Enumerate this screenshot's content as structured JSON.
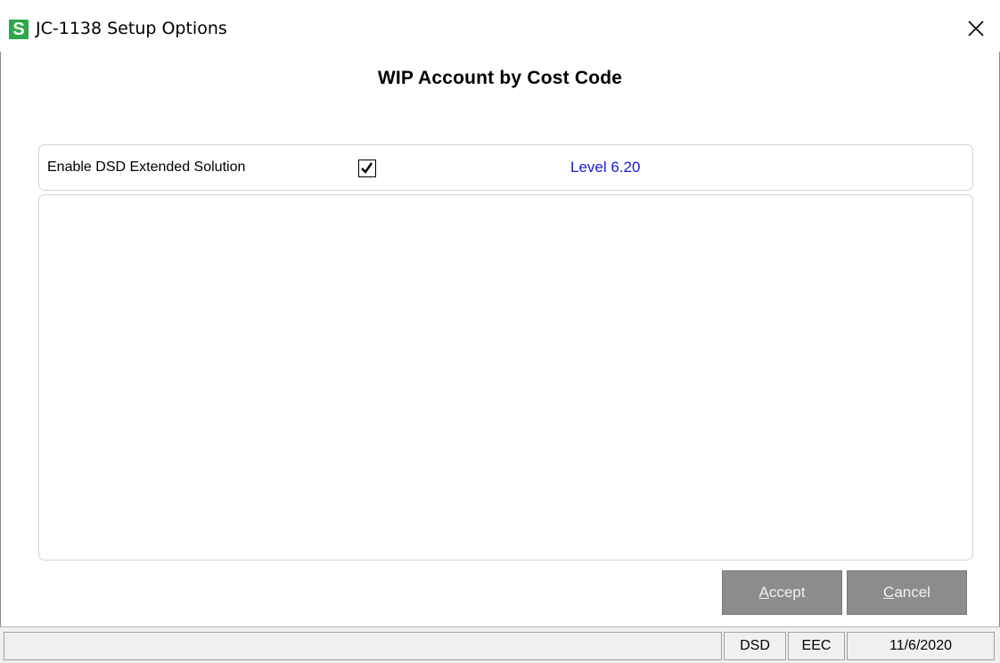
{
  "window": {
    "app_icon_letter": "S",
    "title": "JC-1138 Setup Options",
    "close_icon": "close-icon"
  },
  "heading": "WIP Account by Cost Code",
  "option": {
    "label": "Enable DSD Extended Solution",
    "checked": true,
    "level": "Level  6.20"
  },
  "buttons": {
    "accept": {
      "accel": "A",
      "rest": "ccept"
    },
    "cancel": {
      "accel": "C",
      "rest": "ancel"
    }
  },
  "statusbar": {
    "message": "",
    "company": "DSD",
    "user": "EEC",
    "date": "11/6/2020"
  },
  "colors": {
    "app_icon": "#2ea84a",
    "level_text": "#1a1ad8",
    "button_bg": "#8c8c8c"
  }
}
